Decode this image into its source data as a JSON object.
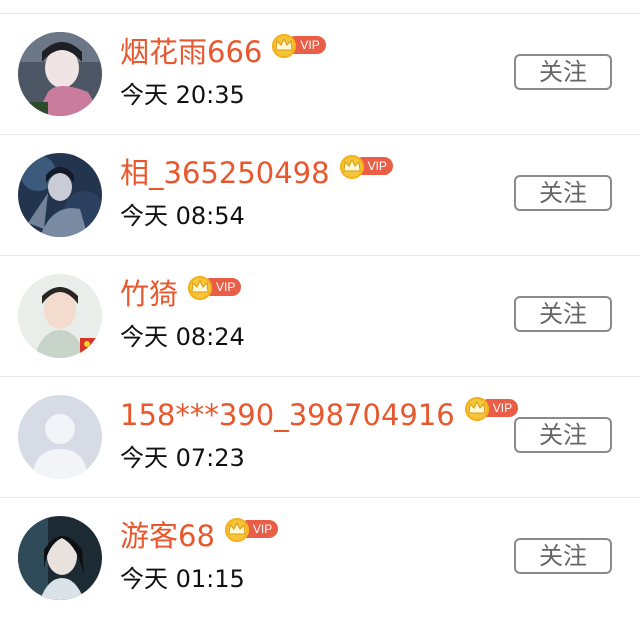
{
  "colors": {
    "username": "#e8582e",
    "vip_badge": "#ea5d46",
    "crown": "#f6c53a",
    "button_border": "#8a8a8a",
    "divider": "#e6e6e6"
  },
  "users": [
    {
      "name": "烟花雨666",
      "vip_label": "VIP",
      "time": "今天 20:35",
      "follow_label": "关注"
    },
    {
      "name": "相_365250498",
      "vip_label": "VIP",
      "time": "今天 08:54",
      "follow_label": "关注"
    },
    {
      "name": "竹猗",
      "vip_label": "VIP",
      "time": "今天 08:24",
      "follow_label": "关注"
    },
    {
      "name": "158***390_398704916",
      "vip_label": "VIP",
      "time": "今天 07:23",
      "follow_label": "关注"
    },
    {
      "name": "游客68",
      "vip_label": "VIP",
      "time": "今天 01:15",
      "follow_label": "关注"
    }
  ]
}
